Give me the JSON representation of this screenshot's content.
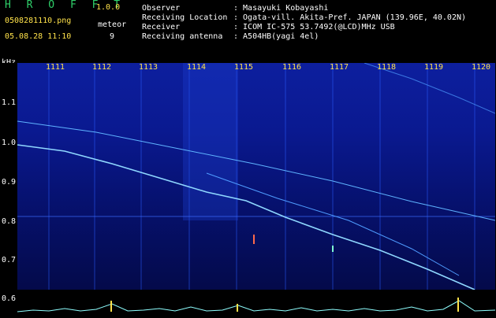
{
  "header": {
    "app_title": "H R O F F T",
    "version": "1.0.0",
    "filename": "0508281110.png",
    "datetime": "05.08.28 11:10",
    "meteor_label": "meteor",
    "meteor_count": "9",
    "labels": {
      "observer": "Observer",
      "location": "Receiving Location",
      "receiver": "Receiver",
      "antenna": "Receiving antenna"
    },
    "values": {
      "observer": ": Masayuki Kobayashi",
      "location": ": Ogata-vill. Akita-Pref. JAPAN (139.96E, 40.02N)",
      "receiver": ": ICOM IC-575 53.7492(@LCD)MHz USB",
      "antenna": ": A504HB(yagi 4el)"
    }
  },
  "axis": {
    "y_unit": "kHz",
    "y_ticks": [
      "1.1",
      "1.0",
      "0.9",
      "0.8",
      "0.7",
      "0.6"
    ],
    "time_ticks": [
      "1111",
      "1112",
      "1113",
      "1114",
      "1115",
      "1116",
      "1117",
      "1118",
      "1119",
      "1120"
    ]
  },
  "colors": {
    "title": "#2fd06a",
    "time_ticks": "#ffe24a",
    "spectrogram": "#0d1f9e",
    "signal": "#8fd8ff"
  }
}
